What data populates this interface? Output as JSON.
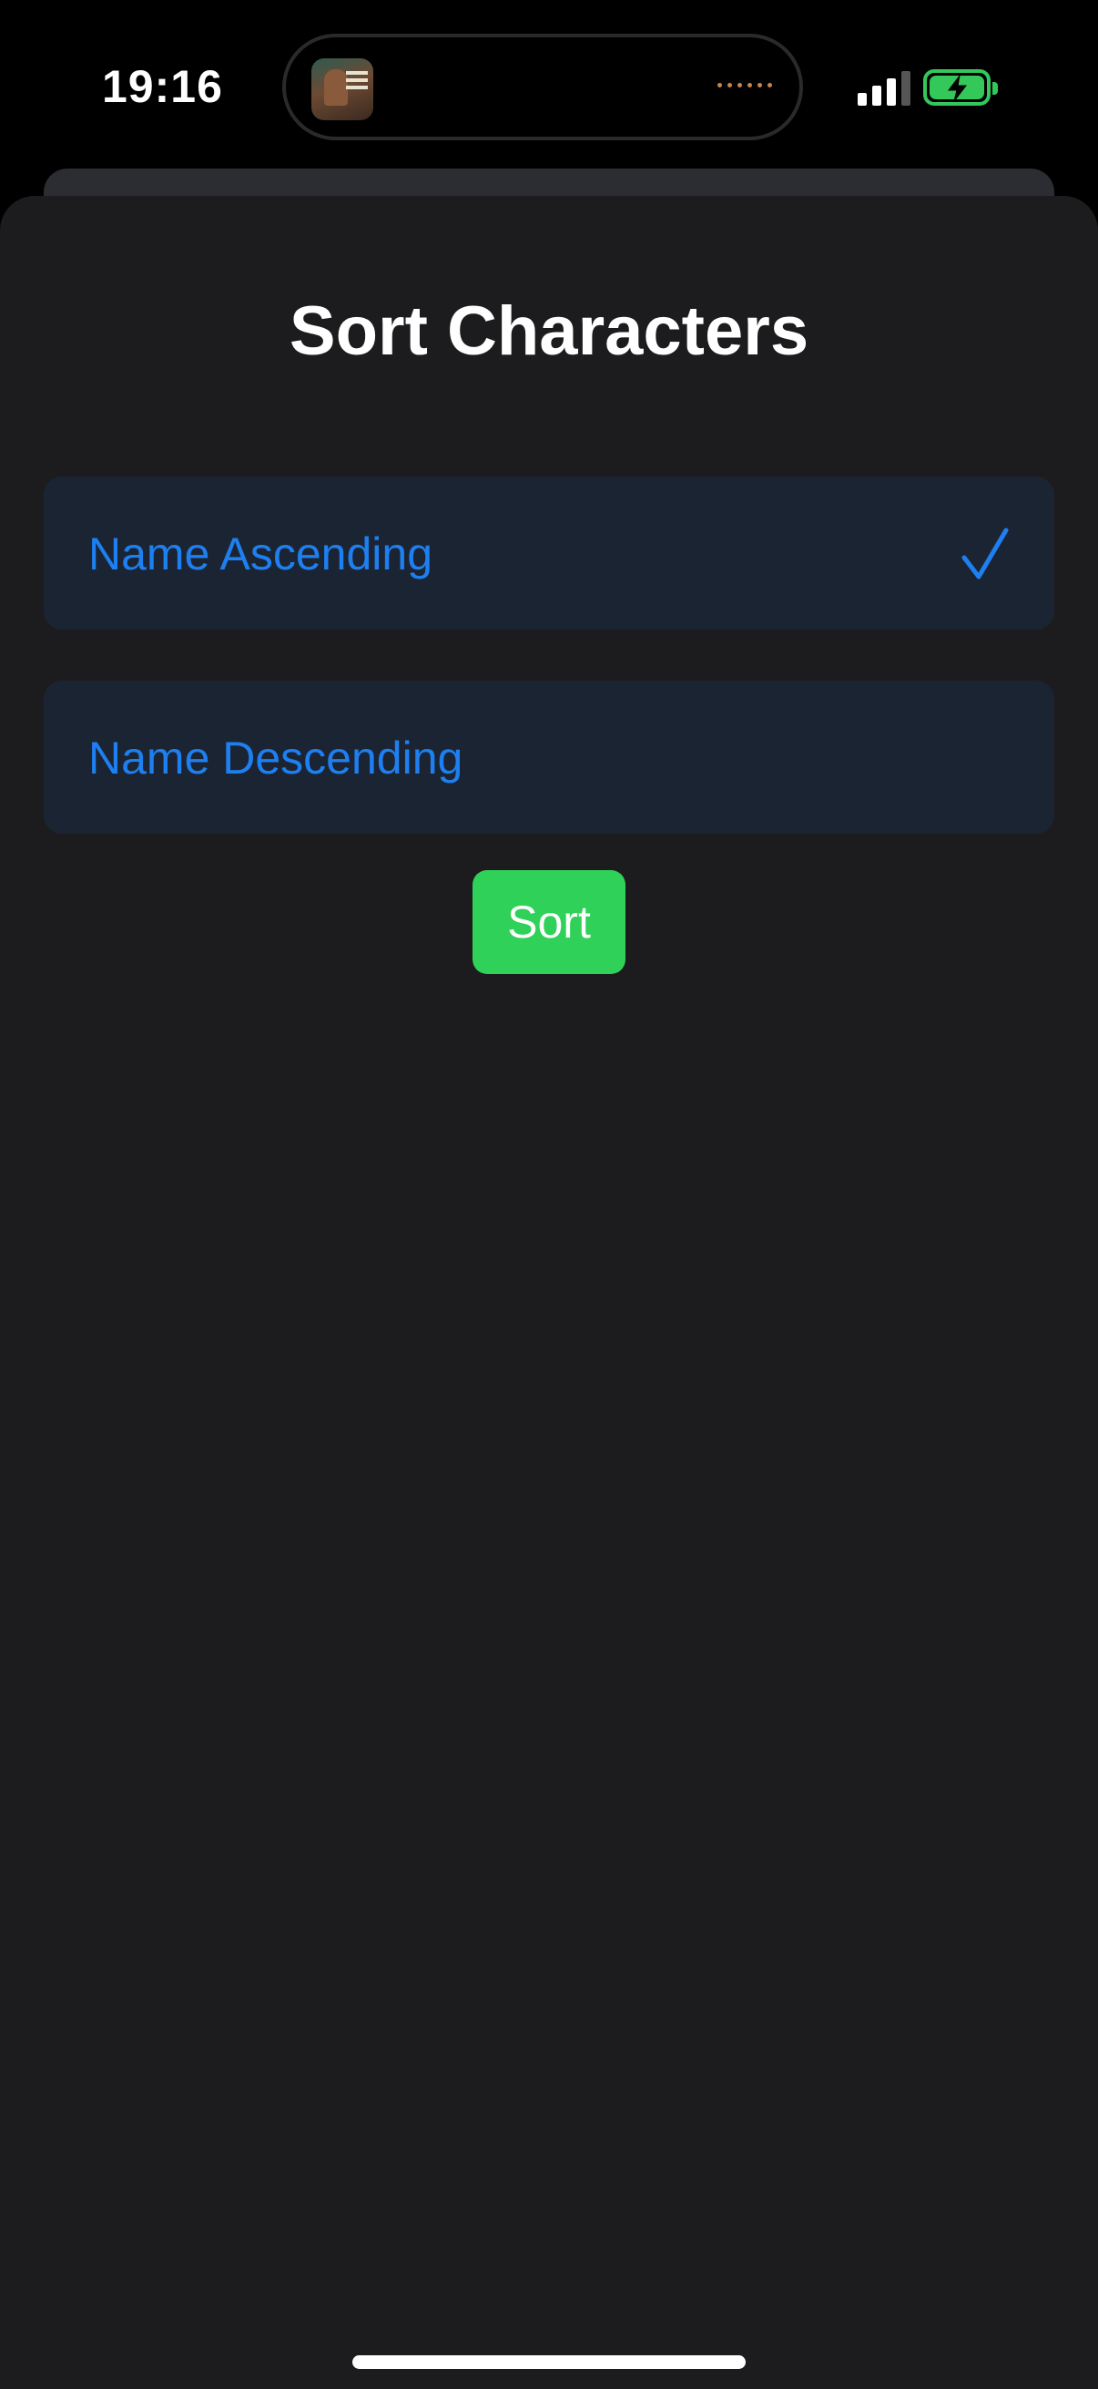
{
  "status_bar": {
    "time": "19:16",
    "accent_color": "#34c759"
  },
  "sheet": {
    "title": "Sort Characters",
    "options": [
      {
        "label": "Name Ascending",
        "selected": true
      },
      {
        "label": "Name Descending",
        "selected": false
      }
    ],
    "sort_label": "Sort",
    "option_color": "#1e7ff0",
    "button_color": "#30d158"
  },
  "icons": {
    "check": "checkmark-icon",
    "signal": "cellular-signal-icon",
    "battery": "battery-charging-icon"
  }
}
